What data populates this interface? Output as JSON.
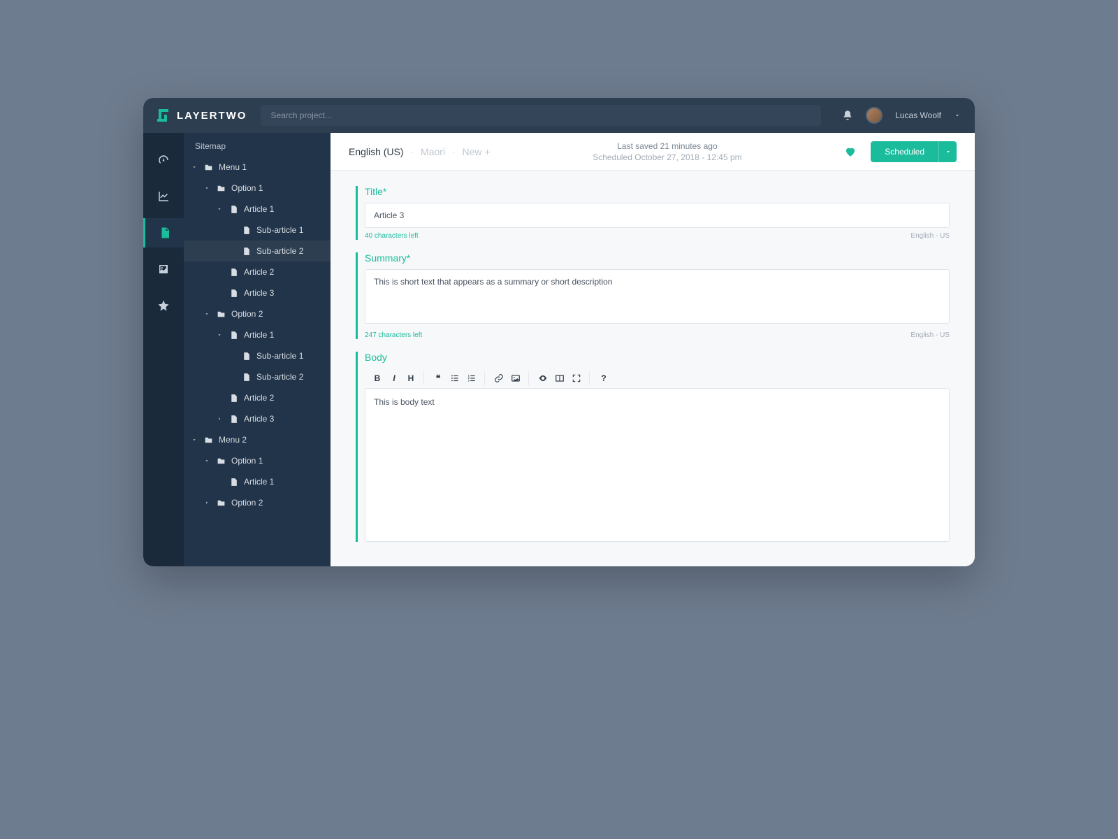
{
  "brand": "LAYERTWO",
  "search": {
    "placeholder": "Search project..."
  },
  "user": {
    "name": "Lucas Woolf"
  },
  "sidebar": {
    "title": "Sitemap",
    "tree": [
      {
        "label": "Menu 1",
        "icon": "folder",
        "caret": "down",
        "indent": 0
      },
      {
        "label": "Option 1",
        "icon": "folder",
        "caret": "down",
        "indent": 1
      },
      {
        "label": "Article 1",
        "icon": "file",
        "caret": "down",
        "indent": 2
      },
      {
        "label": "Sub-article 1",
        "icon": "file",
        "caret": "",
        "indent": 3
      },
      {
        "label": "Sub-article 2",
        "icon": "file",
        "caret": "",
        "indent": 3,
        "selected": true
      },
      {
        "label": "Article 2",
        "icon": "file",
        "caret": "",
        "indent": 2
      },
      {
        "label": "Article 3",
        "icon": "file",
        "caret": "",
        "indent": 2
      },
      {
        "label": "Option 2",
        "icon": "folder",
        "caret": "down",
        "indent": 1
      },
      {
        "label": "Article 1",
        "icon": "file",
        "caret": "down",
        "indent": 2
      },
      {
        "label": "Sub-article 1",
        "icon": "file",
        "caret": "",
        "indent": 3
      },
      {
        "label": "Sub-article 2",
        "icon": "file",
        "caret": "",
        "indent": 3
      },
      {
        "label": "Article 2",
        "icon": "file",
        "caret": "",
        "indent": 2
      },
      {
        "label": "Article 3",
        "icon": "file",
        "caret": "right",
        "indent": 2
      },
      {
        "label": "Menu 2",
        "icon": "folder",
        "caret": "down",
        "indent": 0
      },
      {
        "label": "Option 1",
        "icon": "folder",
        "caret": "down",
        "indent": 1
      },
      {
        "label": "Article 1",
        "icon": "file",
        "caret": "",
        "indent": 2
      },
      {
        "label": "Option 2",
        "icon": "folder",
        "caret": "right",
        "indent": 1
      }
    ]
  },
  "langTabs": {
    "active": "English (US)",
    "inactive": "Maori",
    "new": "New +"
  },
  "status": {
    "lastSaved": "Last saved 21 minutes ago",
    "scheduled": "Scheduled October 27, 2018 - 12:45 pm"
  },
  "scheduleButton": "Scheduled",
  "fields": {
    "title": {
      "label": "Title*",
      "value": "Article 3",
      "charsLeft": "40 characters left",
      "lang": "English - US"
    },
    "summary": {
      "label": "Summary*",
      "value": "This is short text that appears as a summary or short description",
      "charsLeft": "247 characters left",
      "lang": "English - US"
    },
    "body": {
      "label": "Body",
      "value": "This is body text"
    }
  }
}
